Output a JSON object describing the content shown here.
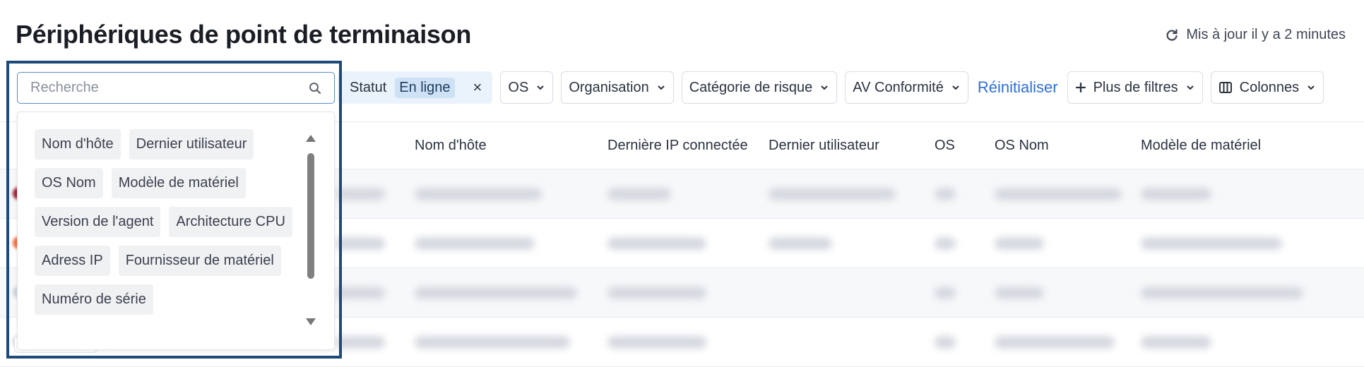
{
  "page": {
    "title": "Périphériques de point de terminaison",
    "updated": "Mis à jour il y a 2 minutes"
  },
  "search": {
    "placeholder": "Recherche"
  },
  "filters": {
    "status_label": "Statut",
    "status_value": "En ligne",
    "os": "OS",
    "organisation": "Organisation",
    "risk": "Catégorie de risque",
    "av": "AV Conformité",
    "reset": "Réinitialiser",
    "more": "Plus de filtres",
    "columns": "Colonnes"
  },
  "table": {
    "headers": {
      "hostname": "Nom d'hôte",
      "last_ip": "Dernière IP connectée",
      "last_user": "Dernier utilisateur",
      "os": "OS",
      "os_name": "OS Nom",
      "hardware_model": "Modèle de matériel"
    },
    "status_colors": [
      "#9b1b30",
      "#f26b3a",
      "#cfd4da",
      "#cfd4da"
    ]
  },
  "column_options": [
    "Nom d'hôte",
    "Dernier utilisateur",
    "OS Nom",
    "Modèle de matériel",
    "Version de l'agent",
    "Architecture CPU",
    "Adress IP",
    "Fournisseur de matériel",
    "Numéro de série"
  ],
  "colors": {
    "accent": "#2f6fd6",
    "highlight_frame": "#1e4a7a",
    "status_chip_bg": "#eaf2fb"
  },
  "icons": {
    "refresh": "refresh-icon",
    "search": "search-icon",
    "chevron": "chevron-down-icon",
    "plus": "plus-icon",
    "columns": "columns-icon",
    "close": "close-icon"
  }
}
